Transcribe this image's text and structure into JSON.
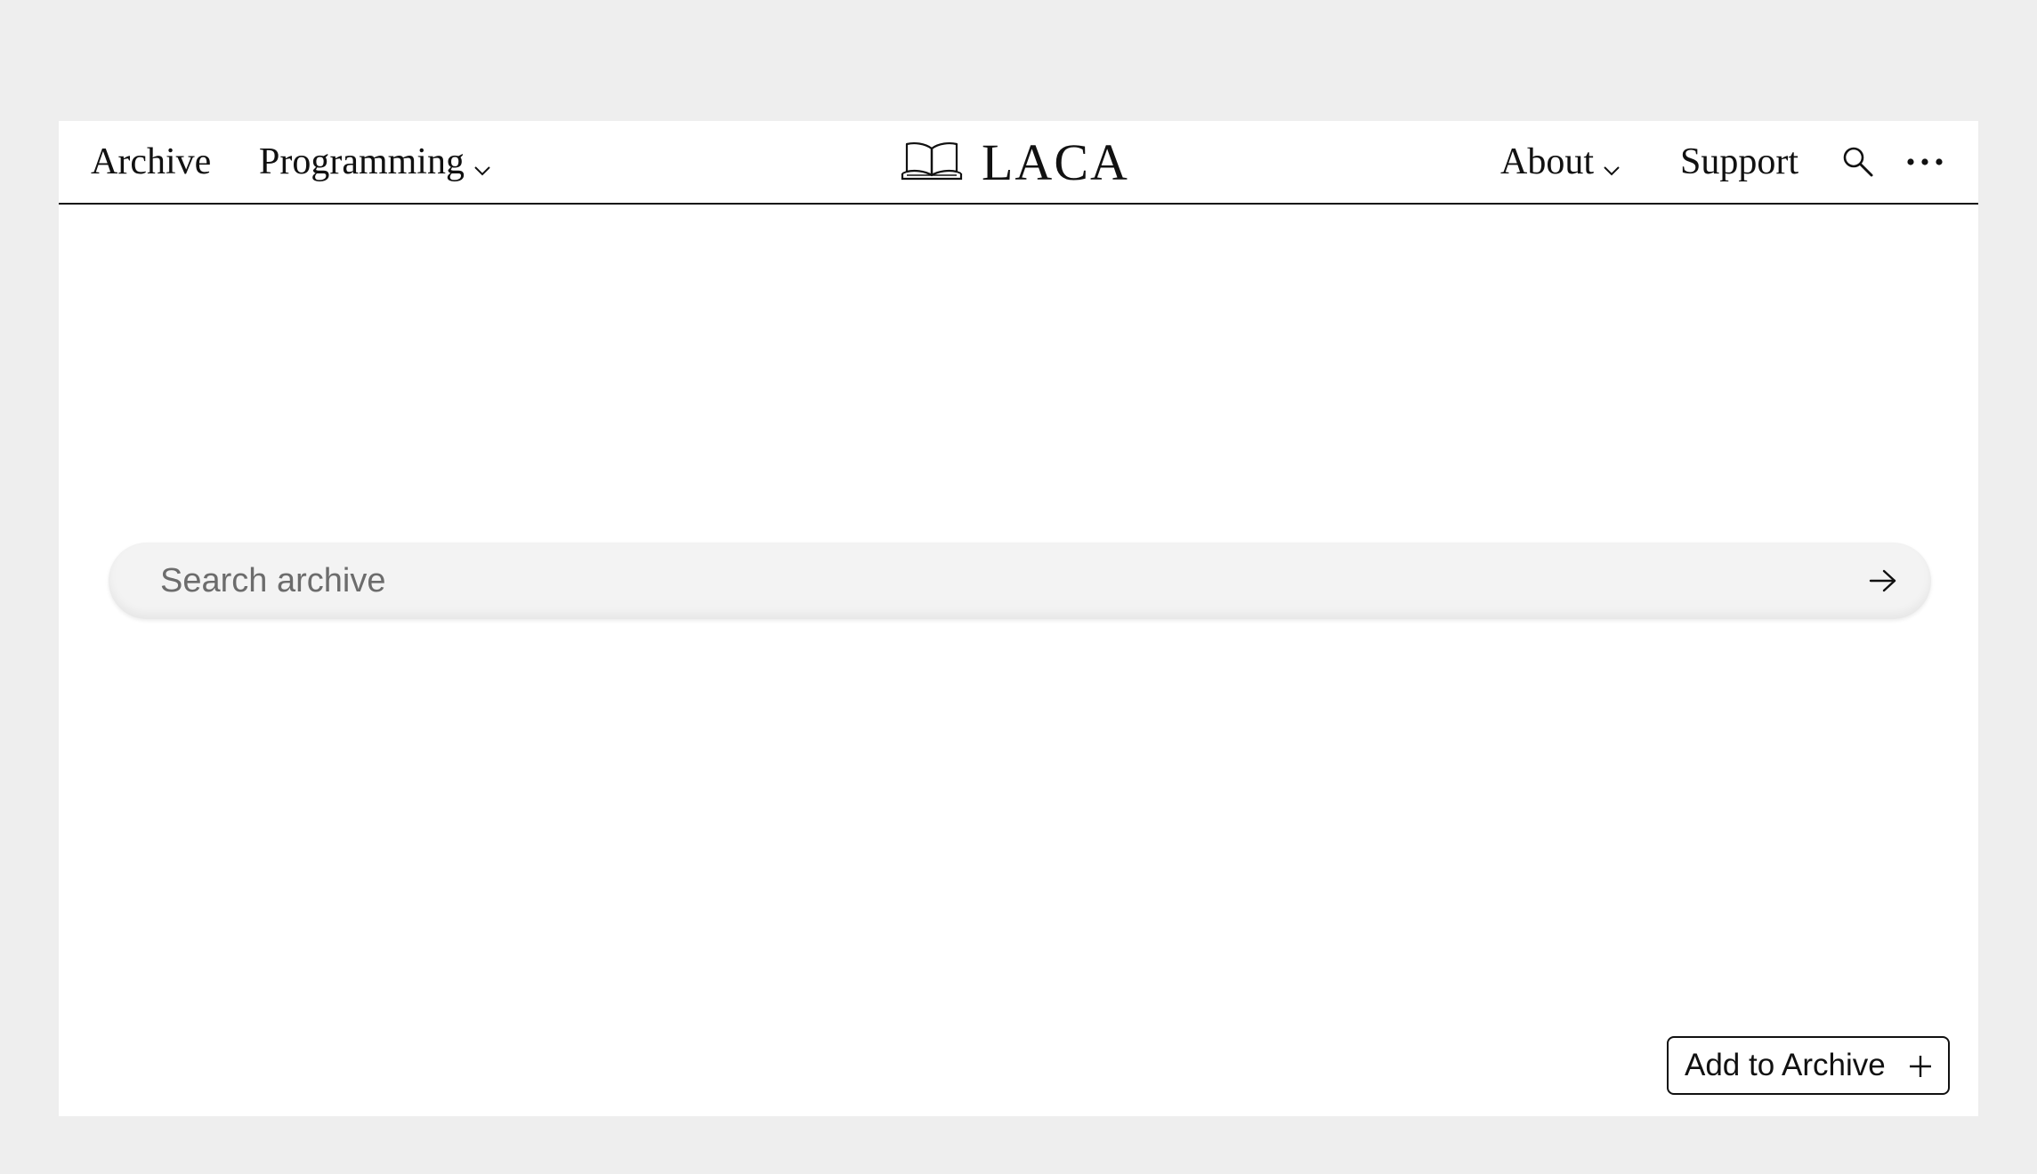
{
  "nav": {
    "left_items": [
      {
        "label": "Archive",
        "has_dropdown": false
      },
      {
        "label": "Programming",
        "has_dropdown": true
      }
    ],
    "brand": {
      "name": "LACA",
      "icon": "open-book-icon"
    },
    "right_items": [
      {
        "label": "About",
        "has_dropdown": true
      },
      {
        "label": "Support",
        "has_dropdown": false
      }
    ],
    "icons": [
      "search-icon",
      "more-icon"
    ]
  },
  "search": {
    "placeholder": "Search archive",
    "value": "",
    "submit_icon": "arrow-right-icon"
  },
  "actions": {
    "add_label": "Add to Archive",
    "add_icon": "plus-icon"
  },
  "colors": {
    "background": "#eeeeee",
    "page": "#ffffff",
    "text": "#111111",
    "search_bar": "#f3f3f3",
    "placeholder": "#6c6c6c"
  }
}
